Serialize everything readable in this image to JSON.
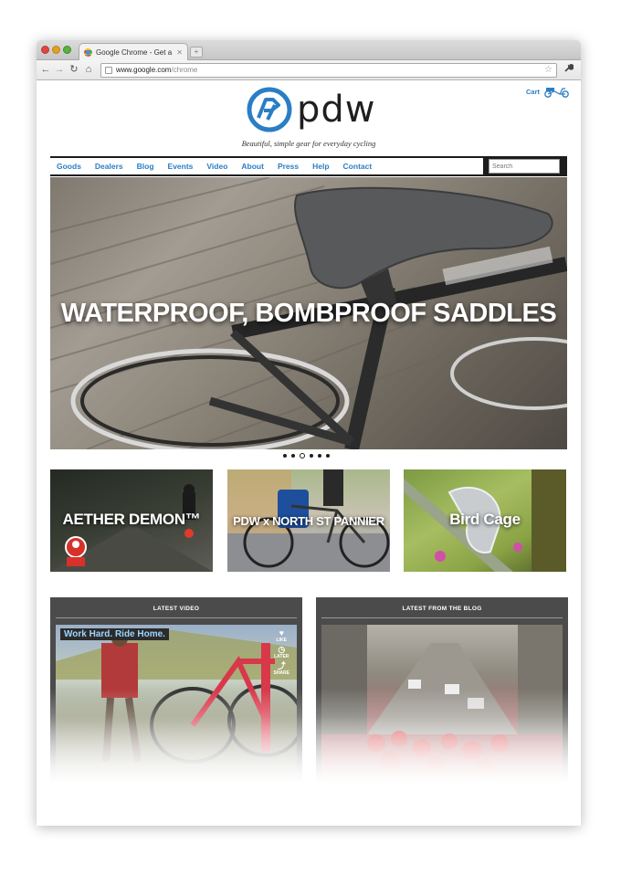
{
  "browser": {
    "tab_title": "Google Chrome - Get a fast",
    "tab_close": "✕",
    "new_tab": "+",
    "url_host": "www.google.com",
    "url_path": "/chrome",
    "back": "←",
    "forward": "→",
    "reload": "↻",
    "home": "⌂",
    "star": "☆",
    "menu": "🔧"
  },
  "site": {
    "logo": "pdw",
    "tagline": "Beautiful, simple gear for everyday cycling",
    "cart": "Cart",
    "accent_color": "#2a7ec5"
  },
  "nav": {
    "items": [
      "Goods",
      "Dealers",
      "Blog",
      "Events",
      "Video",
      "About",
      "Press",
      "Help",
      "Contact"
    ],
    "search_placeholder": "Search"
  },
  "hero": {
    "title": "WATERPROOF, BOMBPROOF SADDLES",
    "slide_count": 6,
    "active_slide": 3
  },
  "promos": [
    {
      "label": "AETHER DEMON™"
    },
    {
      "label": "PDW x NORTH ST PANNIER"
    },
    {
      "label": "Bird Cage"
    }
  ],
  "latest_video": {
    "heading": "LATEST VIDEO",
    "video_title": "Work Hard. Ride Home.",
    "actions": [
      "LIKE",
      "LATER",
      "SHARE"
    ]
  },
  "latest_blog": {
    "heading": "LATEST FROM THE BLOG"
  }
}
